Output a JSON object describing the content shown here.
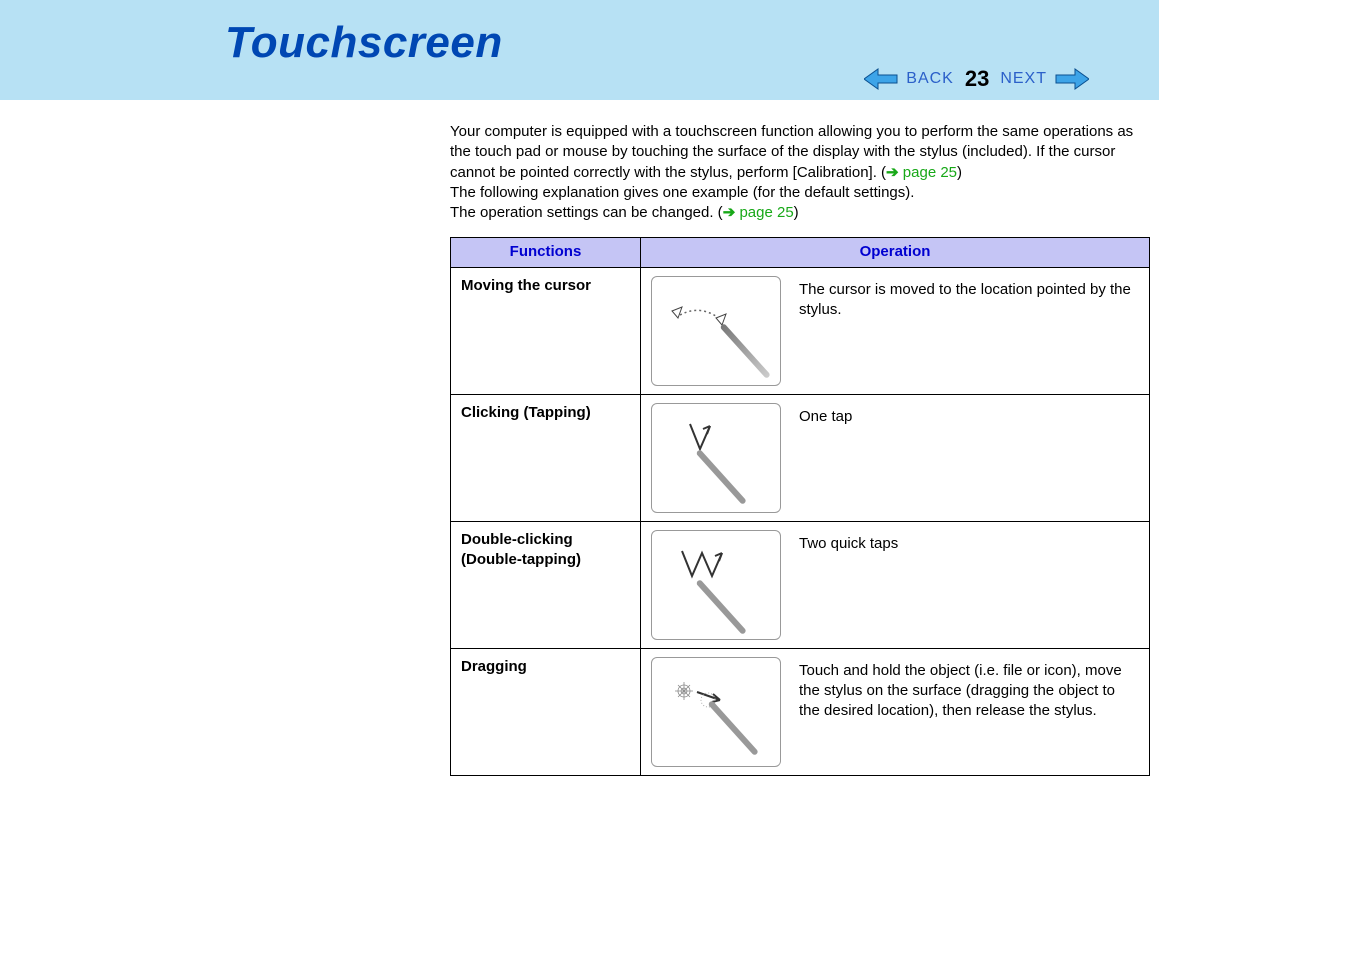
{
  "header": {
    "title": "Touchscreen",
    "back_label": "BACK",
    "page_number": "23",
    "next_label": "NEXT"
  },
  "intro": {
    "p1": "Your computer is equipped with a touchscreen function allowing you to perform the same operations as the touch pad or mouse by touching the surface of the display with the stylus (included).   If the cursor cannot be pointed correctly with the stylus, perform [Calibration]. (",
    "link1": "page 25",
    "p1_close": ")",
    "p2": "The following explanation gives one example (for the default settings).",
    "p3a": "The operation settings can be changed. (",
    "link2": "page 25",
    "p3b": ")"
  },
  "table": {
    "head_functions": "Functions",
    "head_operation": "Operation",
    "rows": [
      {
        "function": "Moving the cursor",
        "operation": "The cursor is moved to the location pointed by the stylus."
      },
      {
        "function": "Clicking (Tapping)",
        "operation": "One tap"
      },
      {
        "function": "Double-clicking (Double-tapping)",
        "operation": "Two quick taps"
      },
      {
        "function": "Dragging",
        "operation": "Touch and hold the object (i.e. file or icon), move the stylus on the surface (dragging the object to the desired location), then release the stylus."
      }
    ]
  }
}
